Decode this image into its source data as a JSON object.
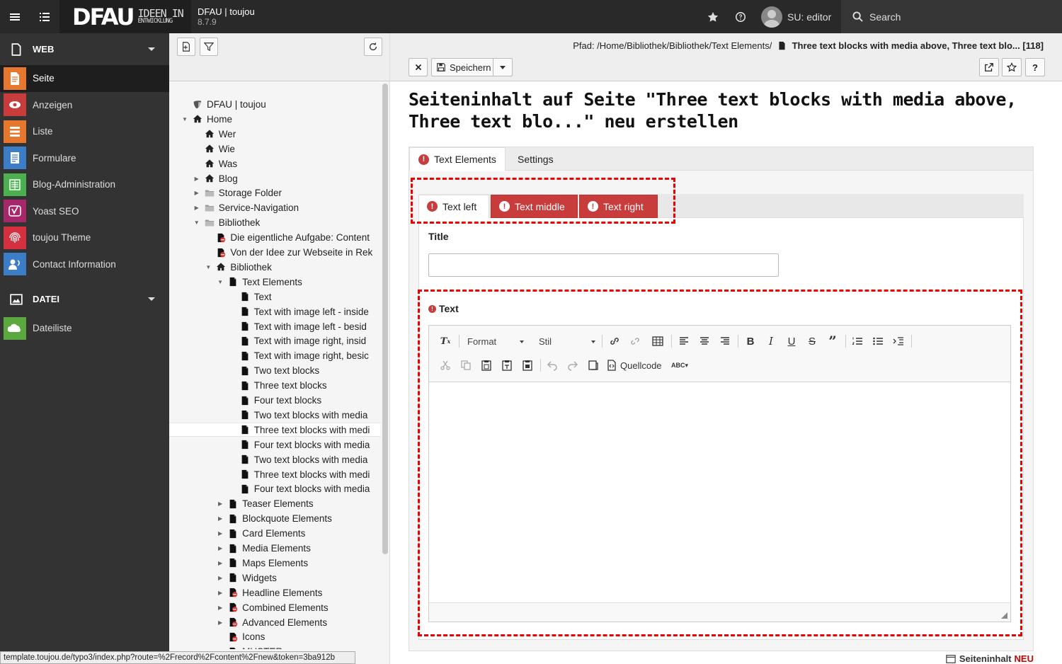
{
  "topbar": {
    "logo": "DFAU",
    "logo_sub1": "IDEEN IN",
    "logo_sub2": "ENTWICKLUNG",
    "site_name": "DFAU | toujou",
    "version": "8.7.9",
    "user_label": "SU: editor",
    "search_label": "Search"
  },
  "modules": {
    "web_group": "WEB",
    "items": [
      {
        "label": "Seite",
        "color": "#e8772e",
        "icon": "page-icon"
      },
      {
        "label": "Anzeigen",
        "color": "#c83c3c",
        "icon": "eye-icon"
      },
      {
        "label": "Liste",
        "color": "#e8772e",
        "icon": "list-icon"
      },
      {
        "label": "Formulare",
        "color": "#3c7dc8",
        "icon": "form-icon"
      },
      {
        "label": "Blog-Administration",
        "color": "#4caf50",
        "icon": "blog-icon"
      },
      {
        "label": "Yoast SEO",
        "color": "#a4286a",
        "icon": "yoast-icon"
      },
      {
        "label": "toujou Theme",
        "color": "#d4303f",
        "icon": "fingerprint-icon"
      },
      {
        "label": "Contact Information",
        "color": "#3c7dc8",
        "icon": "contact-icon"
      }
    ],
    "file_group": "DATEI",
    "file_items": [
      {
        "label": "Dateiliste",
        "color": "#5ba93e",
        "icon": "filelist-icon"
      }
    ]
  },
  "tree": {
    "items": [
      {
        "label": "DFAU | toujou",
        "depth": 0,
        "icon": "typo3",
        "toggle": ""
      },
      {
        "label": "Home",
        "depth": 0,
        "icon": "home",
        "toggle": "open"
      },
      {
        "label": "Wer",
        "depth": 1,
        "icon": "home",
        "toggle": ""
      },
      {
        "label": "Wie",
        "depth": 1,
        "icon": "home",
        "toggle": ""
      },
      {
        "label": "Was",
        "depth": 1,
        "icon": "home",
        "toggle": ""
      },
      {
        "label": "Blog",
        "depth": 1,
        "icon": "home",
        "toggle": "closed"
      },
      {
        "label": "Storage Folder",
        "depth": 1,
        "icon": "folder",
        "toggle": "closed"
      },
      {
        "label": "Service-Navigation",
        "depth": 1,
        "icon": "folder",
        "toggle": "closed"
      },
      {
        "label": "Bibliothek",
        "depth": 1,
        "icon": "folder",
        "toggle": "open"
      },
      {
        "label": "Die eigentliche Aufgabe: Content",
        "depth": 2,
        "icon": "redpage",
        "toggle": ""
      },
      {
        "label": "Von der Idee zur Webseite in Rek",
        "depth": 2,
        "icon": "redpage",
        "toggle": ""
      },
      {
        "label": "Bibliothek",
        "depth": 2,
        "icon": "home",
        "toggle": "open"
      },
      {
        "label": "Text Elements",
        "depth": 3,
        "icon": "page",
        "toggle": "open"
      },
      {
        "label": "Text",
        "depth": 4,
        "icon": "page",
        "toggle": ""
      },
      {
        "label": "Text with image left - inside",
        "depth": 4,
        "icon": "page",
        "toggle": ""
      },
      {
        "label": "Text with image left - besid",
        "depth": 4,
        "icon": "page",
        "toggle": ""
      },
      {
        "label": "Text with image right, insid",
        "depth": 4,
        "icon": "page",
        "toggle": ""
      },
      {
        "label": "Text with image right, besic",
        "depth": 4,
        "icon": "page",
        "toggle": ""
      },
      {
        "label": "Two text blocks",
        "depth": 4,
        "icon": "page",
        "toggle": ""
      },
      {
        "label": "Three text blocks",
        "depth": 4,
        "icon": "page",
        "toggle": ""
      },
      {
        "label": "Four text blocks",
        "depth": 4,
        "icon": "page",
        "toggle": ""
      },
      {
        "label": "Two text blocks with media",
        "depth": 4,
        "icon": "page",
        "toggle": ""
      },
      {
        "label": "Three text blocks with medi",
        "depth": 4,
        "icon": "page",
        "toggle": "",
        "selected": true
      },
      {
        "label": "Four text blocks with media",
        "depth": 4,
        "icon": "page",
        "toggle": ""
      },
      {
        "label": "Two text blocks with media",
        "depth": 4,
        "icon": "page",
        "toggle": ""
      },
      {
        "label": "Three text blocks with medi",
        "depth": 4,
        "icon": "page",
        "toggle": ""
      },
      {
        "label": "Four text blocks with media",
        "depth": 4,
        "icon": "page",
        "toggle": ""
      },
      {
        "label": "Teaser Elements",
        "depth": 3,
        "icon": "page",
        "toggle": "closed"
      },
      {
        "label": "Blockquote Elements",
        "depth": 3,
        "icon": "page",
        "toggle": "closed"
      },
      {
        "label": "Card Elements",
        "depth": 3,
        "icon": "page",
        "toggle": "closed"
      },
      {
        "label": "Media Elements",
        "depth": 3,
        "icon": "page",
        "toggle": "closed"
      },
      {
        "label": "Maps Elements",
        "depth": 3,
        "icon": "page",
        "toggle": "closed"
      },
      {
        "label": "Widgets",
        "depth": 3,
        "icon": "page",
        "toggle": "closed"
      },
      {
        "label": "Headline Elements",
        "depth": 3,
        "icon": "redpage",
        "toggle": "closed"
      },
      {
        "label": "Combined Elements",
        "depth": 3,
        "icon": "redpage",
        "toggle": "closed"
      },
      {
        "label": "Advanced Elements",
        "depth": 3,
        "icon": "redpage",
        "toggle": "closed"
      },
      {
        "label": "Icons",
        "depth": 3,
        "icon": "redpage",
        "toggle": ""
      },
      {
        "label": "MUSTER",
        "depth": 3,
        "icon": "redpage",
        "toggle": ""
      }
    ]
  },
  "status_url": "template.toujou.de/typo3/index.php?route=%2Frecord%2Fcontent%2Fnew&token=3ba912b",
  "docheader": {
    "path_prefix": "Pfad: /Home/Bibliothek/Bibliothek/Text Elements/",
    "path_page": "Three text blocks with media above, Three text blo... [118]",
    "save_label": "Speichern",
    "help_label": "?"
  },
  "editor": {
    "page_title": "Seiteninhalt auf Seite \"Three text blocks with media above, Three text blo...\" neu erstellen",
    "tabs": [
      "Text Elements",
      "Settings"
    ],
    "subtabs": [
      "Text left",
      "Text middle",
      "Text right"
    ],
    "title_label": "Title",
    "title_value": "",
    "text_label": "Text",
    "format_label": "Format",
    "style_label": "Stil",
    "source_label": "Quellcode",
    "footer_label": "Seiteninhalt",
    "footer_badge": "NEU"
  },
  "colors": {
    "error": "#c83c3c",
    "highlight": "#e00000",
    "topbar": "#292929",
    "sidebar": "#333333"
  }
}
